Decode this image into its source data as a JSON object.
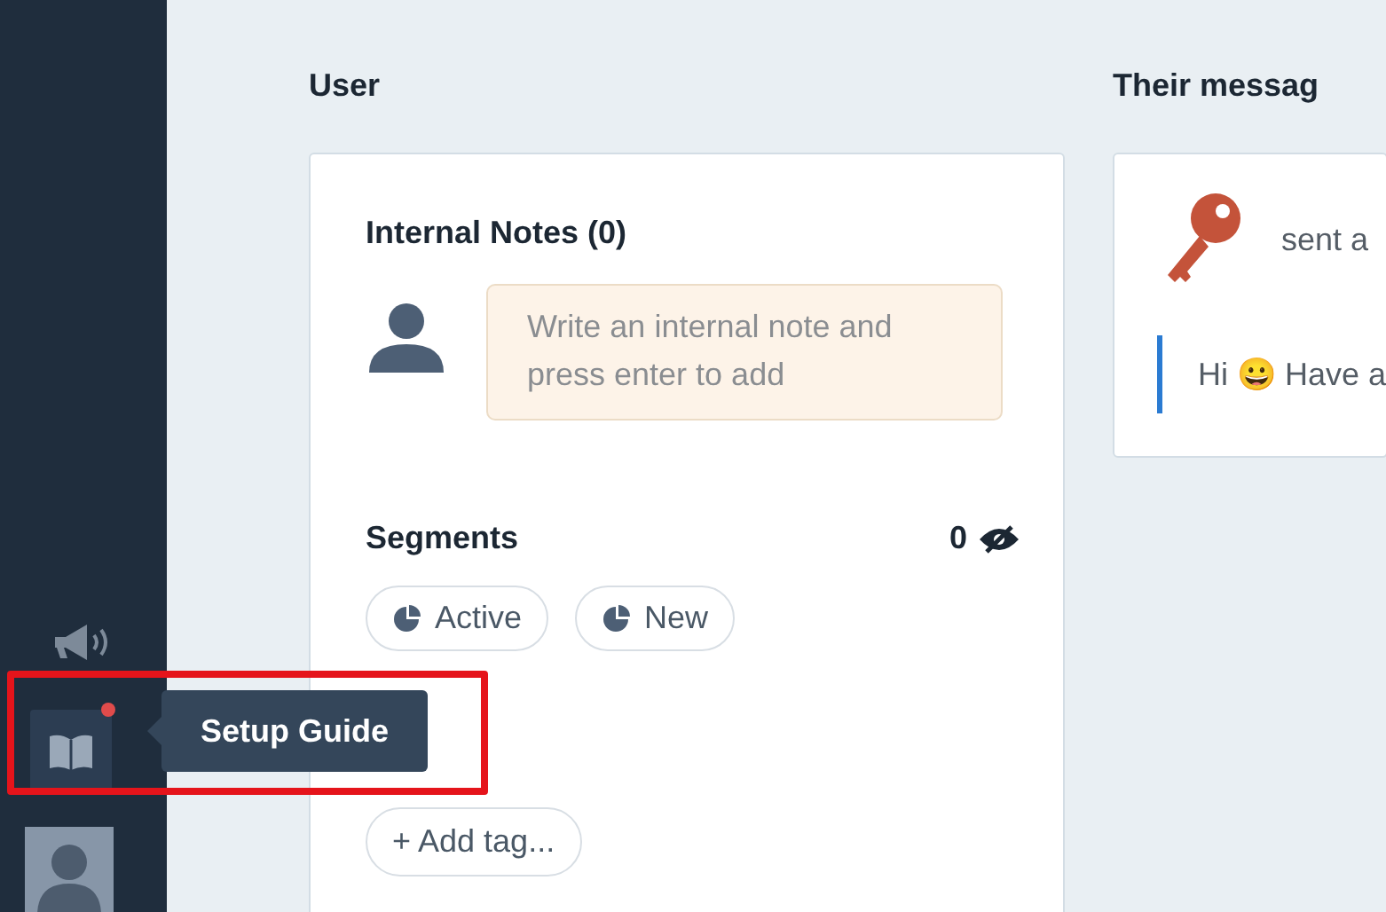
{
  "sidebar": {
    "setup_guide": {
      "has_notification": true,
      "tooltip": "Setup Guide"
    }
  },
  "user_panel": {
    "heading": "User",
    "notes": {
      "title": "Internal Notes (0)",
      "placeholder": "Write an internal note and press enter to add"
    },
    "segments": {
      "title": "Segments",
      "count": "0",
      "items": [
        {
          "label": "Active"
        },
        {
          "label": "New"
        }
      ]
    },
    "tags": {
      "add_label": "+ Add tag..."
    }
  },
  "message_panel": {
    "heading": "Their messag",
    "event": "sent a",
    "quote": "Hi 😀 Have a"
  }
}
